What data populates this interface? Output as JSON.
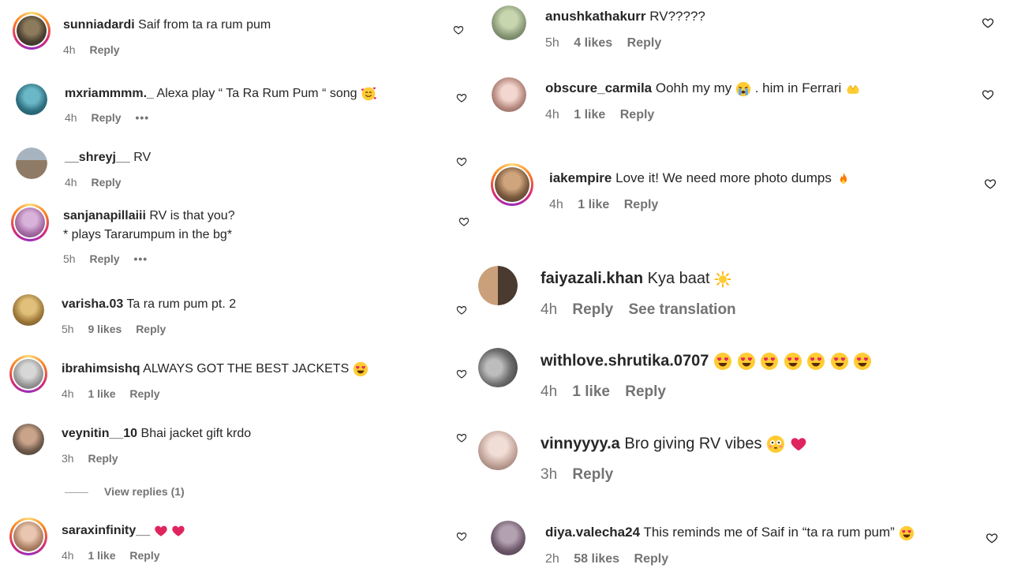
{
  "left": [
    {
      "user": "sunniadardi",
      "text": "Saif from ta ra rum pum",
      "time": "4h",
      "likes": "",
      "reply": "Reply",
      "more": ""
    },
    {
      "user": "mxriammmm._",
      "text": "Alexa play “ Ta Ra Rum Pum “ song",
      "time": "4h",
      "likes": "",
      "reply": "Reply",
      "more": "•••"
    },
    {
      "user": "__shreyj__",
      "text": "RV",
      "time": "4h",
      "likes": "",
      "reply": "Reply",
      "more": ""
    },
    {
      "user": "sanjanapillaiii",
      "text": "RV is that you?",
      "text2": "* plays Tararumpum in the bg*",
      "time": "5h",
      "likes": "",
      "reply": "Reply",
      "more": "•••"
    },
    {
      "user": "varisha.03",
      "text": "Ta ra rum pum pt. 2",
      "time": "5h",
      "likes": "9 likes",
      "reply": "Reply",
      "more": ""
    },
    {
      "user": "ibrahimsishq",
      "text": "ALWAYS GOT THE BEST JACKETS",
      "time": "4h",
      "likes": "1 like",
      "reply": "Reply",
      "more": ""
    },
    {
      "user": "veynitin__10",
      "text": "Bhai jacket gift krdo",
      "time": "3h",
      "likes": "",
      "reply": "Reply",
      "more": ""
    },
    {
      "user": "saraxinfinity__",
      "text": "",
      "time": "4h",
      "likes": "1 like",
      "reply": "Reply",
      "more": ""
    }
  ],
  "view_replies": "View replies (1)",
  "right": [
    {
      "user": "anushkathakurr",
      "text": "RV?????",
      "time": "5h",
      "likes": "4 likes",
      "reply": "Reply",
      "extra": ""
    },
    {
      "user": "obscure_carmila",
      "text": "Oohh my my",
      "text_b": ". him in Ferrari",
      "time": "4h",
      "likes": "1 like",
      "reply": "Reply",
      "extra": ""
    },
    {
      "user": "iakempire",
      "text": "Love it! We need more photo dumps",
      "time": "4h",
      "likes": "1 like",
      "reply": "Reply",
      "extra": ""
    },
    {
      "user": "faiyazali.khan",
      "text": "Kya baat",
      "time": "4h",
      "likes": "",
      "reply": "Reply",
      "extra": "See translation"
    },
    {
      "user": "withlove.shrutika.0707",
      "text": "",
      "time": "4h",
      "likes": "1 like",
      "reply": "Reply",
      "extra": ""
    },
    {
      "user": "vinnyyyy.a",
      "text": "Bro giving RV vibes",
      "time": "3h",
      "likes": "",
      "reply": "Reply",
      "extra": ""
    },
    {
      "user": "diya.valecha24",
      "text": "This reminds me of Saif in “ta ra rum pum”",
      "time": "2h",
      "likes": "58 likes",
      "reply": "Reply",
      "extra": ""
    }
  ],
  "colors": {
    "text": "#262626",
    "meta": "#737373",
    "heart": "#262626",
    "red_heart": "#e0245e"
  },
  "icons": {
    "like": "heart-outline-icon",
    "more": "more-dots-icon",
    "emoji_heart_eyes": "heart-eyes-emoji",
    "emoji_red_heart": "red-heart-emoji",
    "emoji_fire": "fire-emoji",
    "emoji_sun": "sun-emoji",
    "emoji_flushed": "flushed-emoji",
    "emoji_crying": "crying-emoji",
    "emoji_hands": "heart-hands-emoji",
    "emoji_smiling_hearts": "smiling-hearts-emoji"
  }
}
